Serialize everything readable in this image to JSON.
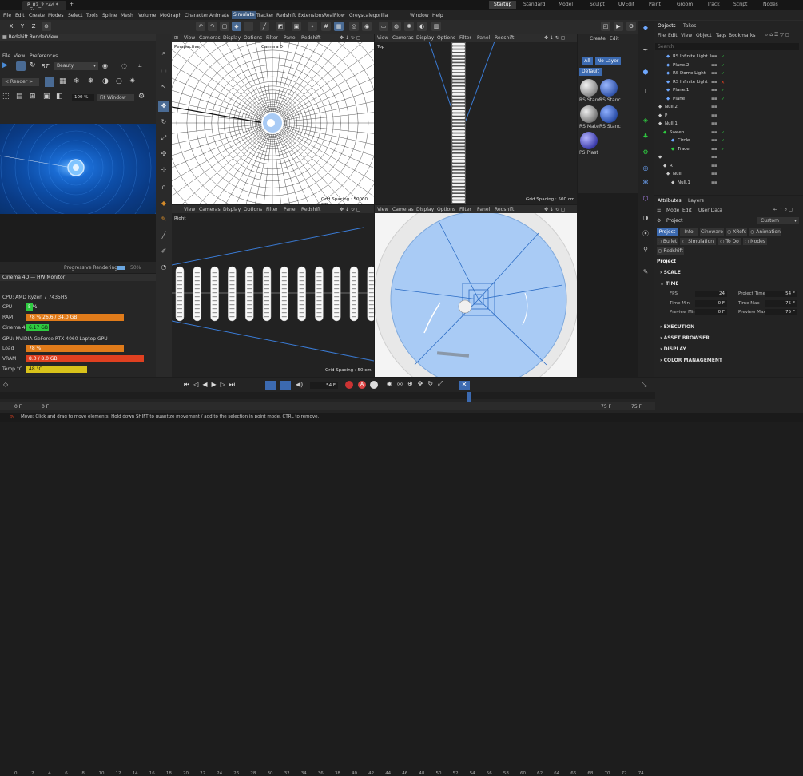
{
  "titlebar": {
    "tab_title": "P_02_2.c4d *",
    "close": "×",
    "new_tab": "+"
  },
  "workspaces": [
    "Startup",
    "Standard",
    "Model",
    "Sculpt",
    "UVEdit",
    "Paint",
    "Groom",
    "Track",
    "Script",
    "Nodes"
  ],
  "active_workspace": "Startup",
  "menu": [
    "File",
    "Edit",
    "Create",
    "Modes",
    "Select",
    "Tools",
    "Spline",
    "Mesh",
    "Volume",
    "MoGraph",
    "Character",
    "Animate",
    "Simulate",
    "Tracker",
    "Redshift",
    "Extensions",
    "RealFlow",
    "Greyscalegorilla",
    "Window",
    "Help"
  ],
  "menu_highlight": "Simulate",
  "axis_buttons": [
    "X",
    "Y",
    "Z"
  ],
  "renderview": {
    "title": "Redshift RenderView",
    "menu": [
      "File",
      "View",
      "Preferences"
    ],
    "rt": "RT",
    "beauty": "Beauty",
    "render_drop": "< Render >",
    "zoom": "100 %",
    "fit": "Fit Window",
    "status": "Progressive Rendering...",
    "progress_pct": "50%"
  },
  "viewport_menu": [
    "View",
    "Cameras",
    "Display",
    "Options",
    "Filter",
    "Panel",
    "Redshift"
  ],
  "viewports": {
    "tl": {
      "name": "Perspective",
      "camera": "Camera",
      "grid": "Grid Spacing : 50000 cm"
    },
    "tr": {
      "name": "Top",
      "grid": "Grid Spacing : 500 cm"
    },
    "bl": {
      "name": "Right",
      "grid": "Grid Spacing : 50 cm"
    },
    "br": {
      "name": ""
    }
  },
  "hwmon": {
    "title": "Cinema 4D — HW Monitor",
    "cpu_label": "CPU: AMD Ryzen 7 7435HS",
    "cpu": "CPU",
    "cpu_val": "5 %",
    "cpu_pct": 5,
    "ram": "RAM",
    "ram_val": "78 %   26.6 / 34.0 GB",
    "ram_pct": 78,
    "c4d": "Cinema 4...",
    "c4d_val": "6.17 GB",
    "c4d_pct": 18,
    "gpu_label": "GPU: NVIDIA GeForce RTX 4060 Laptop GPU",
    "load": "Load",
    "load_val": "78 %",
    "load_pct": 78,
    "vram": "VRAM",
    "vram_val": "8.0 / 8.0 GB",
    "vram_pct": 100,
    "temp": "Temp °C",
    "temp_val": "48 °C",
    "temp_pct": 48
  },
  "materials": {
    "menu": [
      "Create",
      "Edit"
    ],
    "all": "All",
    "no_layer": "No Layer",
    "default": "Default",
    "items": [
      "RS Stanc",
      "RS Stanc",
      "RS Mate",
      "RS Stanc",
      "PS Plast"
    ]
  },
  "objects": {
    "tabs": [
      "Objects",
      "Takes"
    ],
    "menu": [
      "File",
      "Edit",
      "View",
      "Object",
      "Tags",
      "Bookmarks"
    ],
    "search_placeholder": "Search",
    "items": [
      "RS Infinite Light.1",
      "Plane.2",
      "RS Dome Light",
      "RS Infinite Light",
      "Plane.1",
      "Plane",
      "Null.2",
      "P",
      "Null.1",
      "Sweep",
      "Circle",
      "Tracer",
      "",
      "R",
      "Null",
      "Null.1"
    ]
  },
  "attributes": {
    "tabs": [
      "Attributes",
      "Layers"
    ],
    "menu": [
      "Mode",
      "Edit",
      "User Data"
    ],
    "project": "Project",
    "custom": "Custom",
    "subtabs": [
      "Project",
      "Info",
      "Cineware",
      "XRefs",
      "Animation",
      "Bullet",
      "Simulation",
      "To Do",
      "Nodes",
      "Redshift"
    ],
    "section": "Project",
    "scale": "SCALE",
    "time": "TIME",
    "fps_l": "FPS",
    "fps": "24",
    "ptime_l": "Project Time",
    "ptime": "54 F",
    "tmin_l": "Time Min",
    "tmin": "0 F",
    "tmax_l": "Time Max",
    "tmax": "75 F",
    "pmin_l": "Preview Min",
    "pmin": "0 F",
    "pmax_l": "Preview Max",
    "pmax": "75 F",
    "sections": [
      "EXECUTION",
      "ASSET BROWSER",
      "DISPLAY",
      "COLOR MANAGEMENT"
    ]
  },
  "timeline": {
    "frame": "54 F",
    "ticks": [
      "0",
      "2",
      "4",
      "6",
      "8",
      "10",
      "12",
      "14",
      "16",
      "18",
      "20",
      "22",
      "24",
      "26",
      "28",
      "30",
      "32",
      "34",
      "36",
      "38",
      "40",
      "42",
      "44",
      "46",
      "48",
      "50",
      "52",
      "54",
      "56",
      "58",
      "60",
      "62",
      "64",
      "66",
      "68",
      "70",
      "72",
      "74"
    ],
    "start": "0 F",
    "start2": "0 F",
    "end": "75 F",
    "end2": "75 F"
  },
  "status": "Move: Click and drag to move elements. Hold down SHIFT to quantize movement / add to the selection in point mode, CTRL to remove.",
  "colors": {
    "accent": "#3c5a80",
    "orange": "#e07b1a",
    "yellow": "#d8c21a",
    "green": "#2ecc40",
    "red": "#e04020"
  }
}
